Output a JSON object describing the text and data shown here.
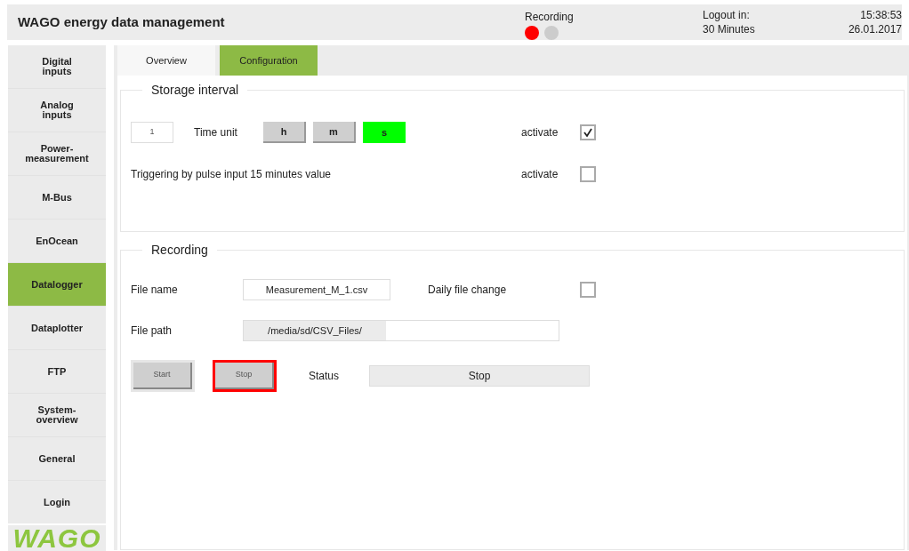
{
  "header": {
    "title": "WAGO energy data management",
    "recording_label": "Recording",
    "indicators": [
      {
        "color": "#ff0000"
      },
      {
        "color": "#cccccc"
      }
    ],
    "logout_label": "Logout in:",
    "logout_value": "30 Minutes",
    "time": "15:38:53",
    "date": "26.01.2017"
  },
  "sidebar": {
    "items": [
      {
        "label": "Digital\ninputs",
        "selected": false
      },
      {
        "label": "Analog\ninputs",
        "selected": false
      },
      {
        "label": "Power-\nmeasurement",
        "selected": false
      },
      {
        "label": "M-Bus",
        "selected": false
      },
      {
        "label": "EnOcean",
        "selected": false
      },
      {
        "label": "Datalogger",
        "selected": true
      },
      {
        "label": "Dataplotter",
        "selected": false
      },
      {
        "label": "FTP",
        "selected": false
      },
      {
        "label": "System-\noverview",
        "selected": false
      },
      {
        "label": "General",
        "selected": false
      },
      {
        "label": "Login",
        "selected": false
      }
    ],
    "logo": "WAGO"
  },
  "tabs": [
    {
      "label": "Overview",
      "selected": false
    },
    {
      "label": "Configuration",
      "selected": true
    }
  ],
  "storage_interval": {
    "title": "Storage interval",
    "value": "1",
    "time_unit_label": "Time unit",
    "units": [
      {
        "label": "h",
        "selected": false
      },
      {
        "label": "m",
        "selected": false
      },
      {
        "label": "s",
        "selected": true
      }
    ],
    "activate_label": "activate",
    "activate_checked": true,
    "trigger_label": "Triggering by pulse input 15 minutes value",
    "trigger_activate_label": "activate",
    "trigger_checked": false
  },
  "recording": {
    "title": "Recording",
    "file_name_label": "File name",
    "file_name": "Measurement_M_1.csv",
    "daily_label": "Daily file change",
    "daily_checked": false,
    "file_path_label": "File path",
    "file_path": "/media/sd/CSV_Files/",
    "buttons": [
      {
        "label": "Start",
        "highlighted": false
      },
      {
        "label": "Stop",
        "highlighted": true
      }
    ],
    "status_label": "Status",
    "status": "Stop"
  }
}
